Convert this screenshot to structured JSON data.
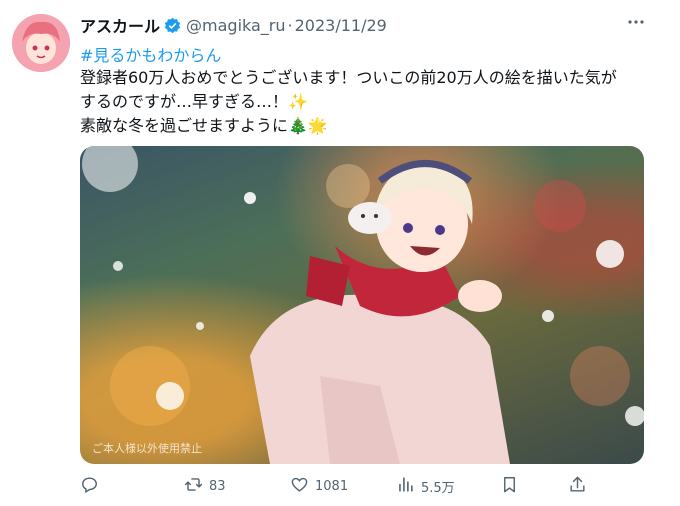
{
  "author": {
    "name": "アスカール",
    "handle": "@magika_ru",
    "separator": "·",
    "date": "2023/11/29"
  },
  "tweet": {
    "hashtag": "#見るかもわからん",
    "lines": [
      "登録者60万人おめでとうございます！ついこの前20万人の絵を描いた気が",
      "するのですが…早すぎる…！✨",
      "素敵な冬を過ごせますように🎄🌟"
    ]
  },
  "image": {
    "watermark": "ご本人様以外使用禁止"
  },
  "actions": {
    "reply_count": "",
    "retweet_count": "83",
    "like_count": "1081",
    "views_count": "5.5万"
  },
  "colors": {
    "link": "#1d9bf0",
    "muted": "#536471",
    "text": "#0f1419"
  },
  "icons": {
    "verified": "verified-badge-icon",
    "more": "more-dots-icon",
    "reply": "reply-icon",
    "retweet": "retweet-icon",
    "like": "heart-icon",
    "views": "views-bars-icon",
    "bookmark": "bookmark-icon",
    "share": "share-icon"
  }
}
